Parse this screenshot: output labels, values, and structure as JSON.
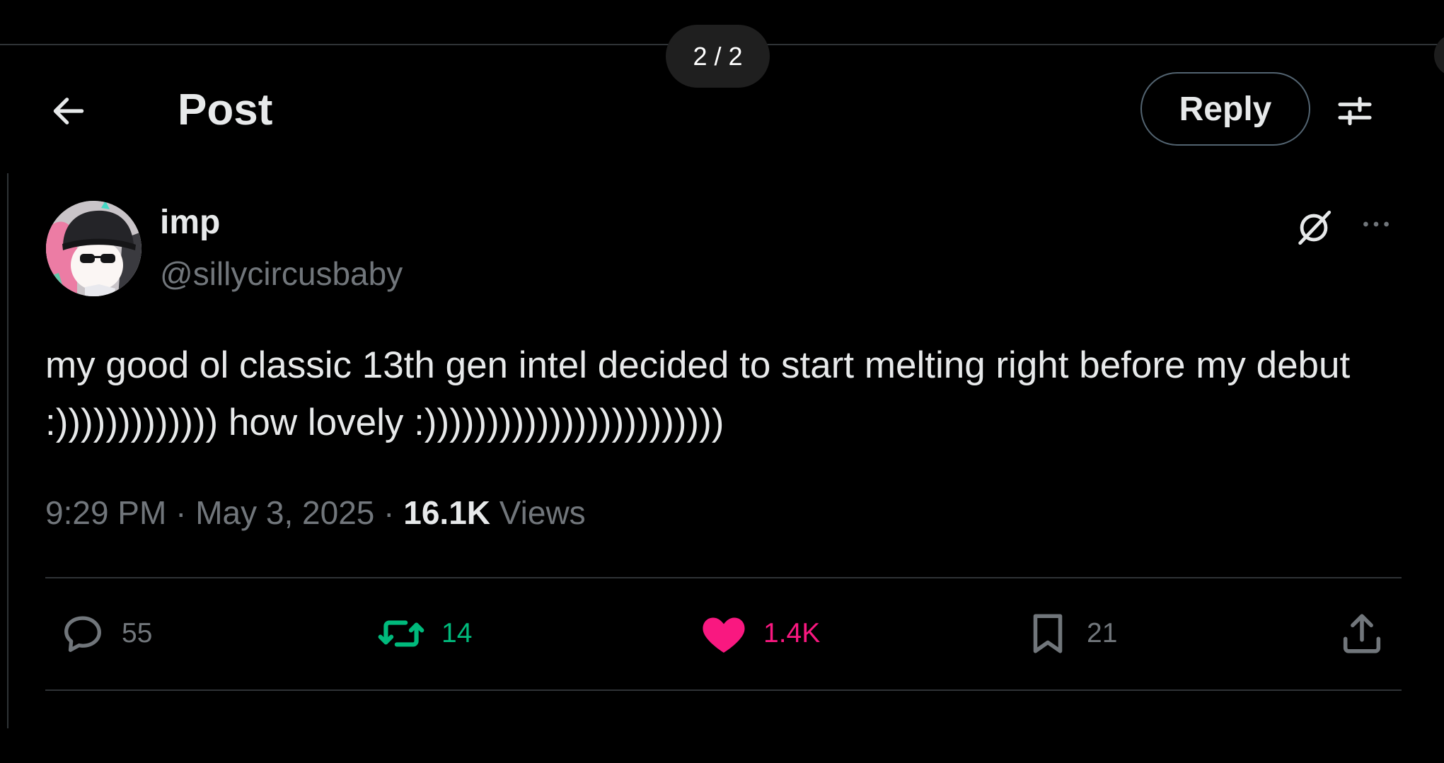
{
  "viewer": {
    "page_counter": "2 / 2"
  },
  "header": {
    "back_icon": "arrow-left-icon",
    "title": "Post",
    "reply_label": "Reply",
    "filter_icon": "sliders-icon"
  },
  "post": {
    "author": {
      "display_name": "imp",
      "handle": "@sillycircusbaby",
      "avatar_icon": "avatar"
    },
    "grok_icon": "grok-icon",
    "more_icon": "more-horizontal-icon",
    "text": "my good ol classic 13th gen intel decided to start melting right before my debut :))))))))))))) how lovely :))))))))))))))))))))))))",
    "time": "9:29 PM",
    "separator": " · ",
    "date": "May 3, 2025",
    "views_count": "16.1K",
    "views_label": " Views"
  },
  "actions": {
    "replies": {
      "icon": "reply-bubble-icon",
      "count": "55"
    },
    "reposts": {
      "icon": "repost-icon",
      "count": "14",
      "color": "#00ba7c"
    },
    "likes": {
      "icon": "heart-icon",
      "count": "1.4K",
      "color": "#f91880"
    },
    "bookmarks": {
      "icon": "bookmark-icon",
      "count": "21"
    },
    "share": {
      "icon": "share-icon"
    }
  },
  "colors": {
    "background": "#000000",
    "text": "#e7e9ea",
    "secondary_text": "#71767b",
    "divider": "#2f3336"
  }
}
